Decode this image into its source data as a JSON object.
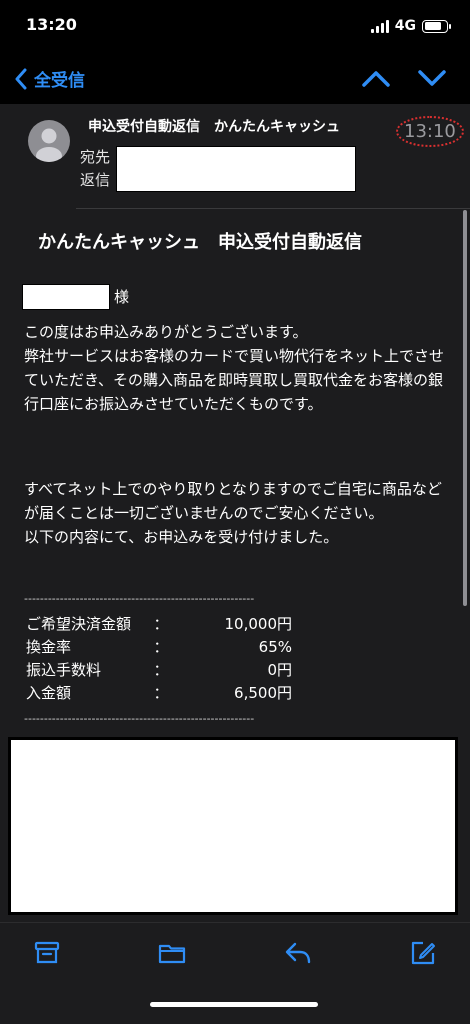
{
  "status_bar": {
    "time": "13:20",
    "network": "4G"
  },
  "nav": {
    "back_label": "全受信"
  },
  "header": {
    "subject": "申込受付自動返信　かんたんキャッシュ",
    "time": "13:10",
    "to_label": "宛先",
    "reply_label": "返信"
  },
  "body": {
    "title": "かんたんキャッシュ　申込受付自動返信",
    "honorific": "様",
    "paragraph1": "この度はお申込みありがとうございます。\n弊社サービスはお客様のカードで買い物代行をネット上でさせていただき、その購入商品を即時買取し買取代金をお客様の銀行口座にお振込みさせていただくものです。",
    "paragraph2": "すべてネット上でのやり取りとなりますのでご自宅に商品などが届くことは一切ございませんのでご安心ください。\n以下の内容にて、お申込みを受け付けました。",
    "divider": "----------------------------------------------------------",
    "summary": [
      {
        "label": "ご希望決済金額",
        "colon": "：",
        "value": "10,000円"
      },
      {
        "label": "換金率",
        "colon": "：",
        "value": "65%"
      },
      {
        "label": "振込手数料",
        "colon": "：",
        "value": "0円"
      },
      {
        "label": "入金額",
        "colon": "：",
        "value": "6,500円"
      }
    ]
  },
  "colors": {
    "accent": "#2f8df5",
    "background": "#1c1c1e",
    "highlight_circle": "#d93030"
  },
  "toolbar": {
    "icons": [
      "archive-icon",
      "folder-icon",
      "reply-icon",
      "compose-icon"
    ]
  }
}
